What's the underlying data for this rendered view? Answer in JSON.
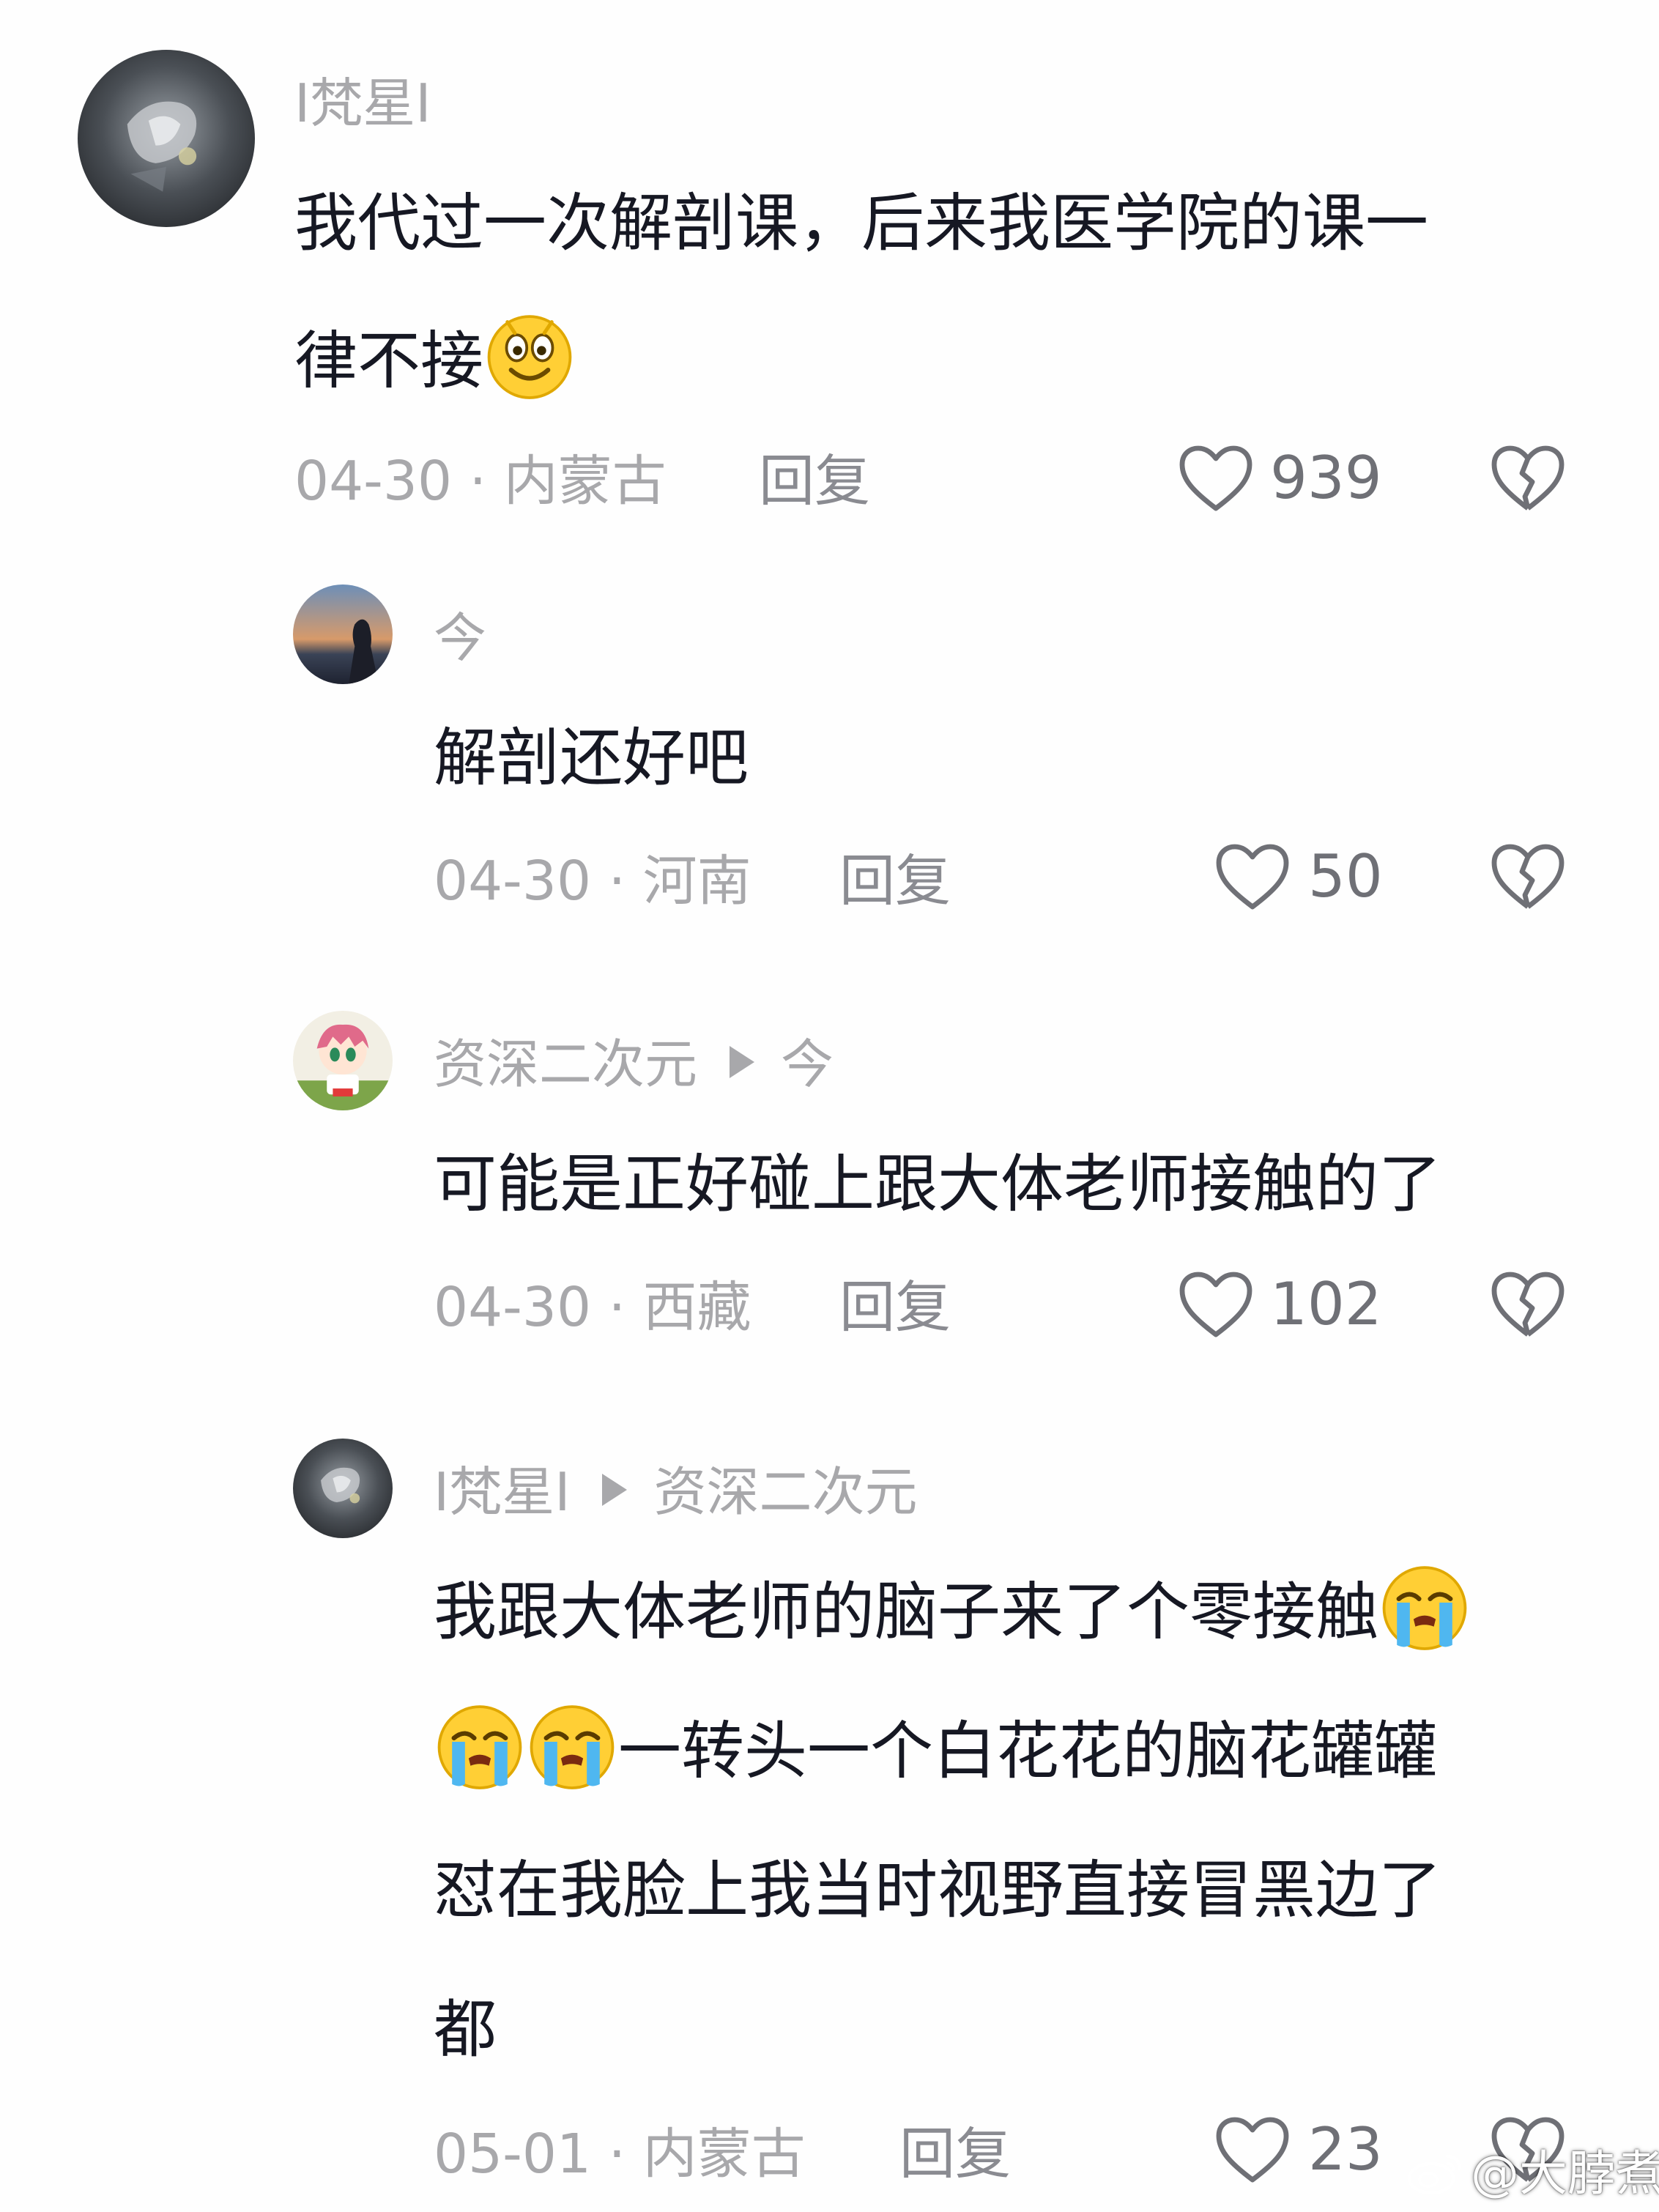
{
  "comments": [
    {
      "username": "I梵星I",
      "reply_to": "",
      "lines": [
        "我代过一次解剖课，后来我医学院的课一",
        "律不接"
      ],
      "line2_emoji": "smiling-face-emoji",
      "date": "04-30",
      "separator": "·",
      "location": "内蒙古",
      "reply_label": "回复",
      "likes": "939"
    },
    {
      "username": "今",
      "reply_to": "",
      "lines": [
        "解剖还好吧"
      ],
      "date": "04-30",
      "separator": "·",
      "location": "河南",
      "reply_label": "回复",
      "likes": "50"
    },
    {
      "username": "资深二次元",
      "reply_to": "今",
      "lines": [
        "可能是正好碰上跟大体老师接触的了"
      ],
      "date": "04-30",
      "separator": "·",
      "location": "西藏",
      "reply_label": "回复",
      "likes": "102"
    },
    {
      "username": "I梵星I",
      "reply_to": "资深二次元",
      "lines": [
        "我跟大体老师的脑子来了个零接触",
        "一转头一个白花花的脑花罐罐",
        "怼在我脸上我当时视野直接冒黑边了",
        "都"
      ],
      "emoji_name": "loudly-crying-emoji",
      "date": "05-01",
      "separator": "·",
      "location": "内蒙古",
      "reply_label": "回复",
      "likes": "23"
    }
  ],
  "watermark": {
    "text": "@大脖煮",
    "icon": "weibo-icon"
  },
  "colors": {
    "background": "#fefefe",
    "text_primary": "#161823",
    "text_secondary": "#a8a8ab",
    "icon_gray": "#6f7076"
  }
}
